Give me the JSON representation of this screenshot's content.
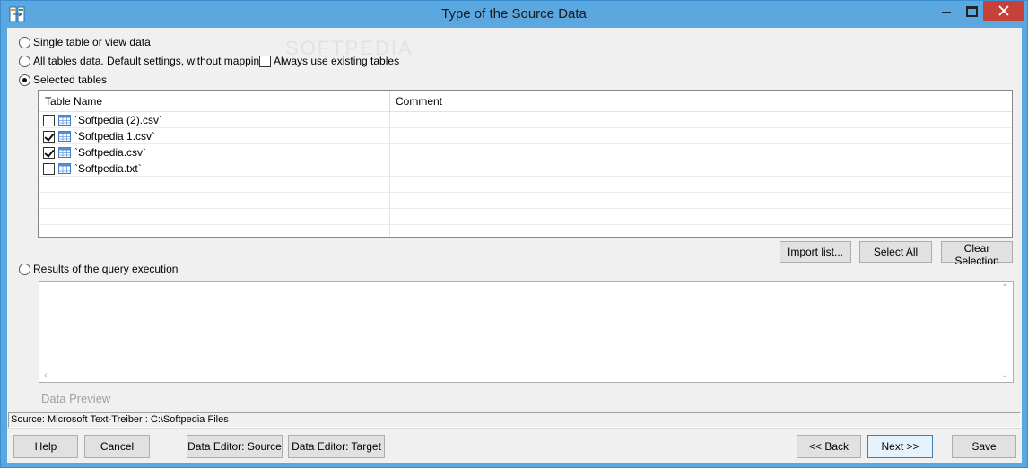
{
  "window": {
    "title": "Type of the Source Data"
  },
  "options": {
    "single": "Single table or view data",
    "all_tables": "All tables data. Default settings, without mapping.",
    "always_existing": "Always use existing tables",
    "selected": "Selected tables",
    "query_results": "Results of the query execution",
    "selected_option": "Selected tables"
  },
  "grid": {
    "columns": [
      "Table Name",
      "Comment"
    ],
    "rows": [
      {
        "name": "`Softpedia (2).csv`",
        "checked": false,
        "comment": ""
      },
      {
        "name": "`Softpedia 1.csv`",
        "checked": true,
        "comment": ""
      },
      {
        "name": "`Softpedia.csv`",
        "checked": true,
        "comment": ""
      },
      {
        "name": "`Softpedia.txt`",
        "checked": false,
        "comment": ""
      }
    ]
  },
  "grid_buttons": {
    "import": "Import list...",
    "select_all": "Select All",
    "clear": "Clear Selection"
  },
  "preview": {
    "label": "Data Preview"
  },
  "status": {
    "text": "Source: Microsoft Text-Treiber : C:\\Softpedia Files"
  },
  "footer": {
    "help": "Help",
    "cancel": "Cancel",
    "editor_source": "Data Editor: Source",
    "editor_target": "Data Editor: Target",
    "back": "<< Back",
    "next": "Next >>",
    "save": "Save"
  },
  "colors": {
    "titlebar": "#5ba7e0",
    "close": "#c7413b",
    "client": "#f0f0f0"
  }
}
